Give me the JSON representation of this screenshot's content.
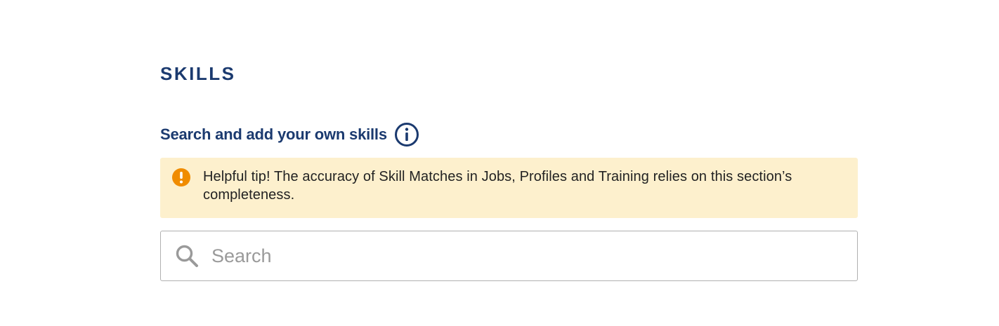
{
  "section": {
    "title": "SKILLS",
    "subheading": "Search and add your own skills"
  },
  "tip": {
    "text": "Helpful tip! The accuracy of Skill Matches in Jobs, Profiles and Training relies on this section’s completeness."
  },
  "search": {
    "value": "",
    "placeholder": "Search"
  },
  "icons": {
    "info": "info-circle-icon",
    "tip": "exclamation-circle-icon",
    "search": "magnifier-icon"
  },
  "colors": {
    "heading": "#1b3a6f",
    "tip_background": "#fdf0cd",
    "tip_icon": "#f08c00",
    "input_border": "#b0b0b0",
    "placeholder": "#9a9a9a"
  }
}
